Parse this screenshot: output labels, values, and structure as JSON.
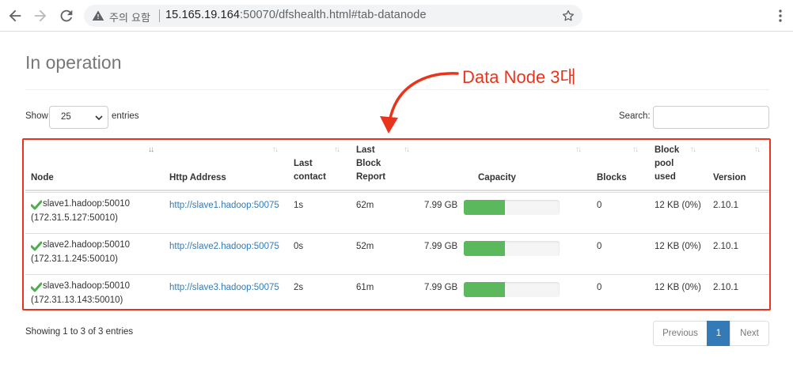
{
  "browser": {
    "security_warning": "주의 요함",
    "url_host": "15.165.19.164",
    "url_rest": ":50070/dfshealth.html#tab-datanode"
  },
  "page": {
    "title": "In operation"
  },
  "annotation": {
    "text": "Data Node 3대",
    "color": "#e8341c"
  },
  "controls": {
    "show_label": "Show",
    "page_length": "25",
    "entries_label": "entries",
    "search_label": "Search:",
    "search_value": ""
  },
  "table": {
    "headers": [
      "Node",
      "Http Address",
      "Last contact",
      "Last Block Report",
      "Capacity",
      "Blocks",
      "Block pool used",
      "Version"
    ],
    "rows": [
      {
        "node": "slave1.hadoop:50010",
        "ip": "(172.31.5.127:50010)",
        "http": "http://slave1.hadoop:50075",
        "last_contact": "1s",
        "last_block_report": "62m",
        "capacity": "7.99 GB",
        "capacity_used_fraction": 0.43,
        "blocks": "0",
        "block_pool_used": "12 KB (0%)",
        "version": "2.10.1"
      },
      {
        "node": "slave2.hadoop:50010",
        "ip": "(172.31.1.245:50010)",
        "http": "http://slave2.hadoop:50075",
        "last_contact": "0s",
        "last_block_report": "52m",
        "capacity": "7.99 GB",
        "capacity_used_fraction": 0.43,
        "blocks": "0",
        "block_pool_used": "12 KB (0%)",
        "version": "2.10.1"
      },
      {
        "node": "slave3.hadoop:50010",
        "ip": "(172.31.13.143:50010)",
        "http": "http://slave3.hadoop:50075",
        "last_contact": "2s",
        "last_block_report": "61m",
        "capacity": "7.99 GB",
        "capacity_used_fraction": 0.43,
        "blocks": "0",
        "block_pool_used": "12 KB (0%)",
        "version": "2.10.1"
      }
    ]
  },
  "footer": {
    "info": "Showing 1 to 3 of 3 entries",
    "previous": "Previous",
    "current_page": "1",
    "next": "Next"
  },
  "colors": {
    "link": "#337ab7",
    "progress": "#5cb85c",
    "status_ok": "#4cae4c"
  }
}
